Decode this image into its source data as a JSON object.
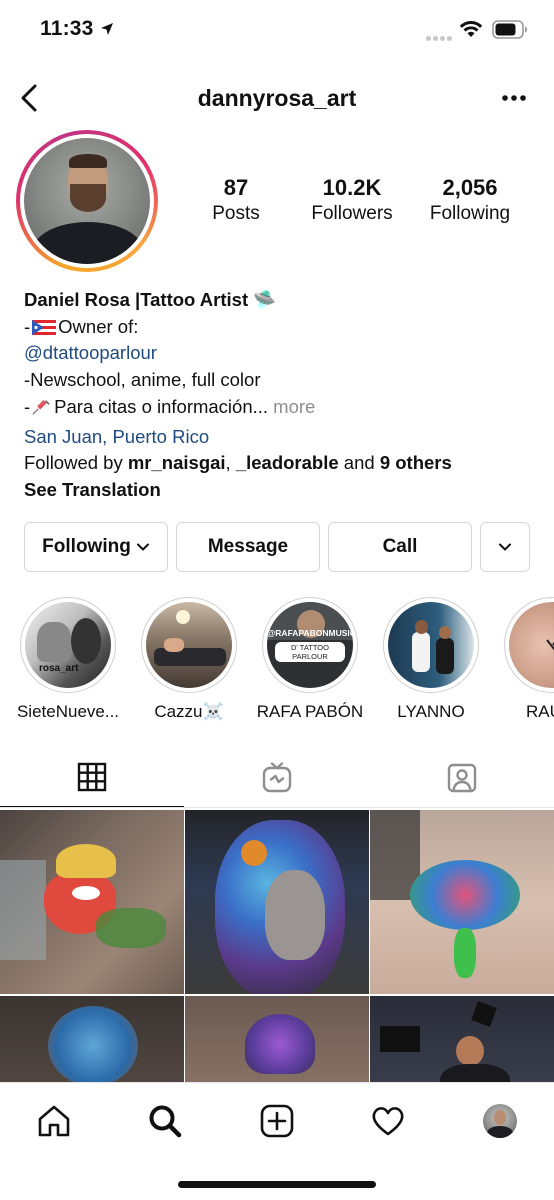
{
  "status_bar": {
    "time": "11:33"
  },
  "header": {
    "username": "dannyrosa_art"
  },
  "profile": {
    "stats": [
      {
        "value": "87",
        "label": "Posts"
      },
      {
        "value": "10.2K",
        "label": "Followers"
      },
      {
        "value": "2,056",
        "label": "Following"
      }
    ],
    "bio": {
      "name": "Daniel Rosa |Tattoo Artist",
      "name_emoji": "🛸",
      "line2_prefix": "-",
      "line2_text": "Owner of:",
      "mention": "@dtattooparlour",
      "line4": "-Newschool, anime, full color",
      "line5_prefix": "-",
      "line5_text": "Para citas o información...",
      "more": " more",
      "location": "San Juan, Puerto Rico",
      "followed_by_prefix": "Followed by ",
      "followed_user1": "mr_naisgai",
      "followed_sep": ", ",
      "followed_user2": "_leadorable",
      "followed_and": " and ",
      "followed_others": "9 others",
      "see_translation": "See Translation"
    }
  },
  "actions": {
    "following": "Following",
    "message": "Message",
    "call": "Call"
  },
  "highlights": [
    {
      "label": "SieteNueve...",
      "image_text": "rosa_art"
    },
    {
      "label": "Cazzu☠️"
    },
    {
      "label": "RAFA PABÓN",
      "image_text1": "@RAFAPABONMUSIC",
      "image_text2": "D' TATTOO PARLOUR"
    },
    {
      "label": "LYANNO"
    },
    {
      "label": "RAUW"
    }
  ],
  "colors": {
    "link": "#1f4b82",
    "muted": "#8e8e8e",
    "ring_start": "#f5a623",
    "ring_end": "#c13584"
  },
  "icons": {
    "tabs": [
      "grid-icon",
      "igtv-icon",
      "tagged-icon"
    ],
    "bottom_nav": [
      "home-icon",
      "search-icon",
      "new-post-icon",
      "activity-heart-icon",
      "profile-avatar-icon"
    ]
  }
}
